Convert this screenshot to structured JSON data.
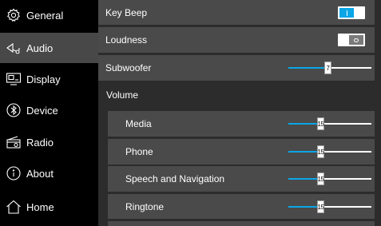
{
  "sidebar": {
    "items": [
      {
        "label": "General",
        "icon": "gear-icon"
      },
      {
        "label": "Audio",
        "icon": "speaker-icon",
        "active": true
      },
      {
        "label": "Display",
        "icon": "display-icon"
      },
      {
        "label": "Device",
        "icon": "bluetooth-icon"
      },
      {
        "label": "Radio",
        "icon": "radio-icon"
      },
      {
        "label": "About",
        "icon": "info-icon"
      },
      {
        "label": "Home",
        "icon": "home-icon"
      }
    ]
  },
  "settings": {
    "key_beep": {
      "label": "Key Beep",
      "on": true
    },
    "loudness": {
      "label": "Loudness",
      "on": false
    },
    "subwoofer": {
      "label": "Subwoofer",
      "value": "7",
      "level_percent": 44
    },
    "volume_title": "Volume",
    "volumes": [
      {
        "label": "Media",
        "value": "15",
        "level_percent": 36
      },
      {
        "label": "Phone",
        "value": "15",
        "level_percent": 36
      },
      {
        "label": "Speech and Navigation",
        "value": "15",
        "level_percent": 36
      },
      {
        "label": "Ringtone",
        "value": "15",
        "level_percent": 36
      }
    ]
  },
  "colors": {
    "accent": "#0aa6e6",
    "row": "#4a4a4a",
    "active_nav": "#484848"
  }
}
